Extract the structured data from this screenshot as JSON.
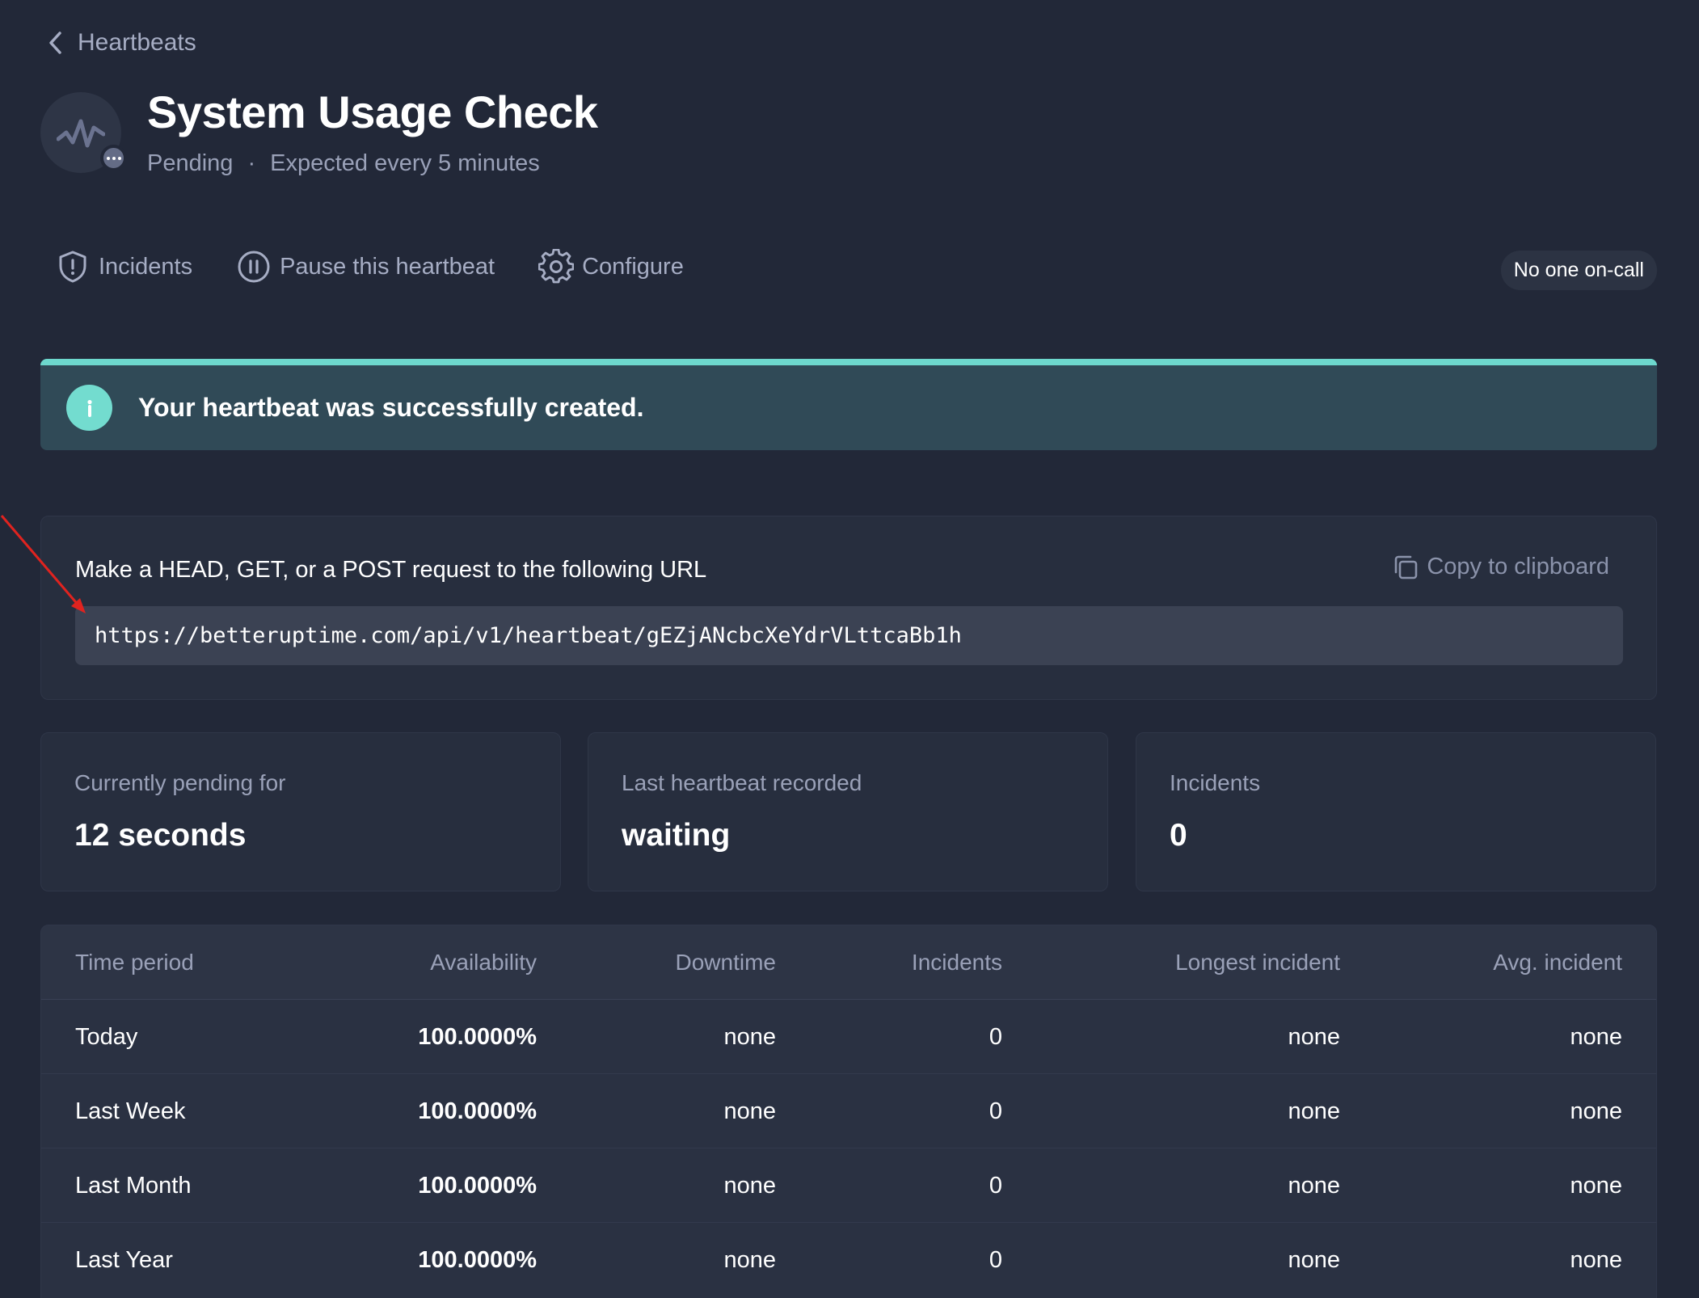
{
  "breadcrumb": {
    "label": "Heartbeats"
  },
  "header": {
    "title": "System Usage Check",
    "status": "Pending",
    "separator": "·",
    "frequency": "Expected every 5 minutes"
  },
  "toolbar": {
    "incidents_label": "Incidents",
    "pause_label": "Pause this heartbeat",
    "configure_label": "Configure",
    "oncall_label": "No one on-call"
  },
  "banner": {
    "message": "Your heartbeat was successfully created."
  },
  "url_card": {
    "instruction": "Make a HEAD, GET, or a POST request to the following URL",
    "copy_label": "Copy to clipboard",
    "url": "https://betteruptime.com/api/v1/heartbeat/gEZjANcbcXeYdrVLttcaBb1h"
  },
  "stats": [
    {
      "label": "Currently pending for",
      "value": "12 seconds"
    },
    {
      "label": "Last heartbeat recorded",
      "value": "waiting"
    },
    {
      "label": "Incidents",
      "value": "0"
    }
  ],
  "table": {
    "headers": [
      "Time period",
      "Availability",
      "Downtime",
      "Incidents",
      "Longest incident",
      "Avg. incident"
    ],
    "rows": [
      [
        "Today",
        "100.0000%",
        "none",
        "0",
        "none",
        "none"
      ],
      [
        "Last Week",
        "100.0000%",
        "none",
        "0",
        "none",
        "none"
      ],
      [
        "Last Month",
        "100.0000%",
        "none",
        "0",
        "none",
        "none"
      ],
      [
        "Last Year",
        "100.0000%",
        "none",
        "0",
        "none",
        "none"
      ]
    ]
  },
  "colors": {
    "background": "#222838",
    "banner_accent": "#6dd8cd",
    "annotation_arrow": "#e0231f"
  },
  "icons": [
    "chevron-left-icon",
    "heartbeat-pulse-icon",
    "more-dots-icon",
    "shield-alert-icon",
    "pause-circle-icon",
    "gear-icon",
    "info-icon",
    "copy-icon"
  ]
}
